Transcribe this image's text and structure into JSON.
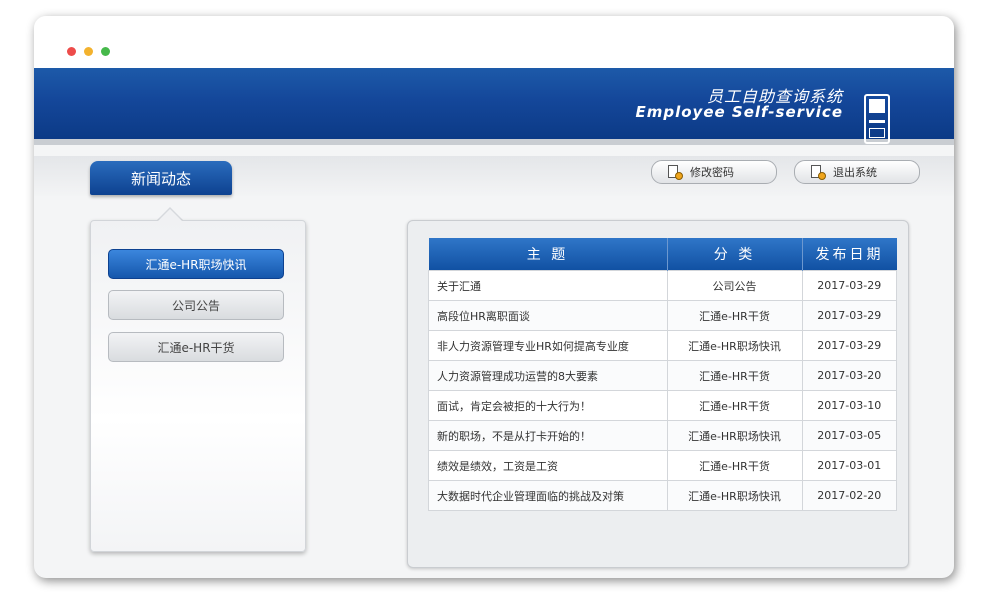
{
  "header": {
    "system_title_cn": "员工自助查询系统",
    "system_title_en": "Employee Self-service"
  },
  "toolbar": {
    "news_tab": "新闻动态",
    "change_password": "修改密码",
    "logout": "退出系统"
  },
  "categories": [
    {
      "label": "汇通e-HR职场快讯",
      "active": true
    },
    {
      "label": "公司公告",
      "active": false
    },
    {
      "label": "汇通e-HR干货",
      "active": false
    }
  ],
  "table": {
    "headers": [
      "主 题",
      "分 类",
      "发布日期"
    ],
    "rows": [
      {
        "subject": "关于汇通",
        "category": "公司公告",
        "date": "2017-03-29"
      },
      {
        "subject": "高段位HR离职面谈",
        "category": "汇通e-HR干货",
        "date": "2017-03-29"
      },
      {
        "subject": "非人力资源管理专业HR如何提高专业度",
        "category": "汇通e-HR职场快讯",
        "date": "2017-03-29"
      },
      {
        "subject": "人力资源管理成功运营的8大要素",
        "category": "汇通e-HR干货",
        "date": "2017-03-20"
      },
      {
        "subject": "面试，肯定会被拒的十大行为！",
        "category": "汇通e-HR干货",
        "date": "2017-03-10"
      },
      {
        "subject": "新的职场，不是从打卡开始的！",
        "category": "汇通e-HR职场快讯",
        "date": "2017-03-05"
      },
      {
        "subject": "绩效是绩效，工资是工资",
        "category": "汇通e-HR干货",
        "date": "2017-03-01"
      },
      {
        "subject": "大数据时代企业管理面临的挑战及对策",
        "category": "汇通e-HR职场快讯",
        "date": "2017-02-20"
      }
    ]
  },
  "colors": {
    "brand_blue": "#14479a",
    "active_button": "#1557ac",
    "window_dot_red": "#ed4c4a",
    "window_dot_yellow": "#f3b22e",
    "window_dot_green": "#46b94b"
  },
  "icons": [
    "window-close-dot",
    "window-minimize-dot",
    "window-maximize-dot",
    "kiosk-icon",
    "document-key-icon",
    "document-exit-icon"
  ]
}
